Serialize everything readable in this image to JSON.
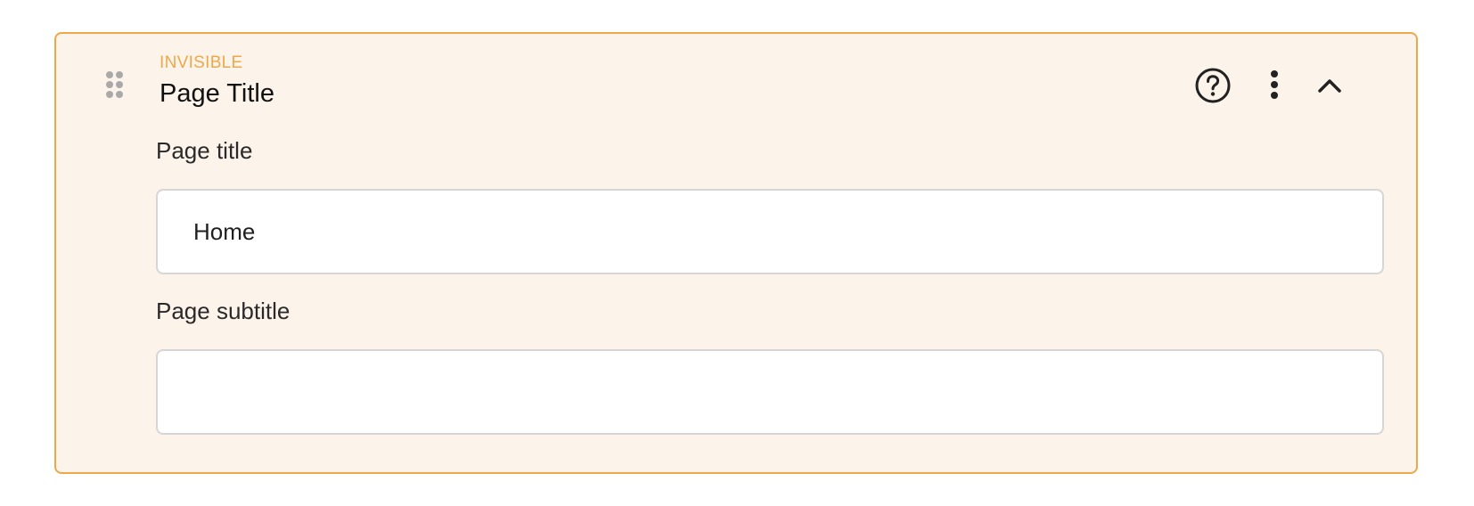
{
  "block": {
    "badge": "INVISIBLE",
    "title": "Page Title",
    "accent_color": "#eda84a",
    "background_color": "#fcf3ea"
  },
  "actions": {
    "help_icon": "question-circle-icon",
    "more_icon": "vertical-dots-icon",
    "collapse_icon": "chevron-up-icon",
    "drag_icon": "drag-handle-icon"
  },
  "fields": {
    "page_title": {
      "label": "Page title",
      "value": "Home",
      "placeholder": ""
    },
    "page_subtitle": {
      "label": "Page subtitle",
      "value": "",
      "placeholder": ""
    }
  }
}
